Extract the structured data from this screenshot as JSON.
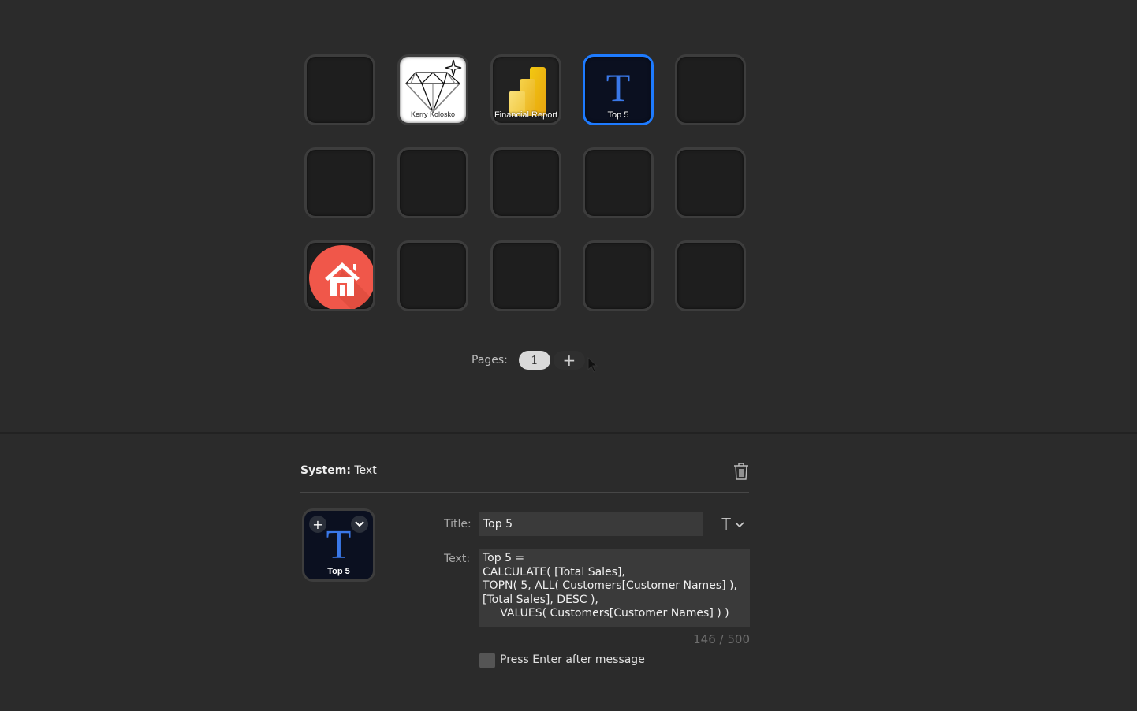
{
  "grid": {
    "keys": [
      {
        "row": 0,
        "col": 0,
        "type": "empty",
        "label": ""
      },
      {
        "row": 0,
        "col": 1,
        "type": "image",
        "icon": "diamond-icon",
        "label": "Kerry Kolosko"
      },
      {
        "row": 0,
        "col": 2,
        "type": "image",
        "icon": "powerbi-icon",
        "label": "Financial Report"
      },
      {
        "row": 0,
        "col": 3,
        "type": "text",
        "icon": "text-t-icon",
        "glyph": "T",
        "label": "Top 5",
        "selected": true
      },
      {
        "row": 0,
        "col": 4,
        "type": "empty",
        "label": ""
      },
      {
        "row": 1,
        "col": 0,
        "type": "empty",
        "label": ""
      },
      {
        "row": 1,
        "col": 1,
        "type": "empty",
        "label": ""
      },
      {
        "row": 1,
        "col": 2,
        "type": "empty",
        "label": ""
      },
      {
        "row": 1,
        "col": 3,
        "type": "empty",
        "label": ""
      },
      {
        "row": 1,
        "col": 4,
        "type": "empty",
        "label": ""
      },
      {
        "row": 2,
        "col": 0,
        "type": "image",
        "icon": "home-icon",
        "label": ""
      },
      {
        "row": 2,
        "col": 1,
        "type": "empty",
        "label": ""
      },
      {
        "row": 2,
        "col": 2,
        "type": "empty",
        "label": ""
      },
      {
        "row": 2,
        "col": 3,
        "type": "empty",
        "label": ""
      },
      {
        "row": 2,
        "col": 4,
        "type": "empty",
        "label": ""
      }
    ]
  },
  "pages": {
    "label": "Pages:",
    "current": "1",
    "add_label": "+"
  },
  "editor": {
    "system_label": "System:",
    "system_value": "Text",
    "delete_icon": "trash-icon",
    "preview": {
      "glyph": "T",
      "label": "Top 5",
      "add_icon": "+",
      "menu_icon": "chevron-down"
    },
    "title_label": "Title:",
    "title_value": "Top 5",
    "font_button": "T",
    "text_label": "Text:",
    "text_value": "Top 5 = \nCALCULATE( [Total Sales],\nTOPN( 5, ALL( Customers[Customer Names] ),\n[Total Sales], DESC ),\n     VALUES( Customers[Customer Names] ) )",
    "char_count": "146 / 500",
    "press_enter_label": "Press Enter after message",
    "press_enter_checked": false
  },
  "colors": {
    "accent": "#1e7bff",
    "background": "#2b2b2b",
    "key_background": "#1e1e1e",
    "home_red": "#f0574a",
    "text_blue": "#3a78e8"
  }
}
